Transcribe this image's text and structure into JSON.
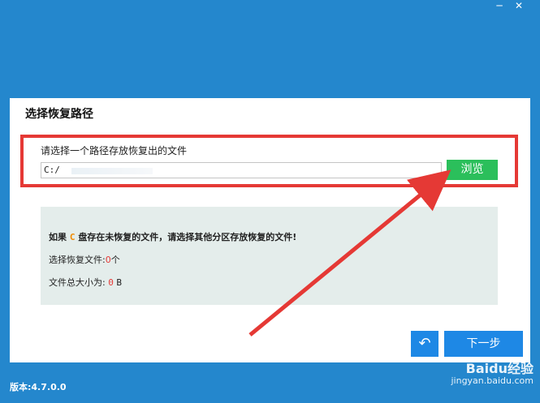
{
  "window": {
    "minimize_icon": "minimize-icon",
    "close_icon": "close-icon"
  },
  "dialog": {
    "title": "选择恢复路径",
    "path_label": "请选择一个路径存放恢复出的文件",
    "path_value": "C:/",
    "browse_label": "浏览",
    "info": {
      "warning_prefix": "如果",
      "drive": "C",
      "warning_suffix": "盘存在未恢复的文件，请选择其他分区存放恢复的文件!",
      "selected_label": "选择恢复文件:",
      "selected_count": "0",
      "selected_unit": "个",
      "total_size_label": "文件总大小为:",
      "total_size_value": "0",
      "total_size_unit": "B"
    },
    "next_label": "下一步",
    "back_icon": "back-arrow-icon"
  },
  "version": "版本:4.7.0.0",
  "watermark": {
    "brand": "Baidu经验",
    "url": "jingyan.baidu.com"
  },
  "colors": {
    "background": "#2487cd",
    "accent_button": "#1e88e5",
    "browse_button": "#2bbf5b",
    "highlight": "#e53935",
    "info_bg": "#e4edeb"
  }
}
